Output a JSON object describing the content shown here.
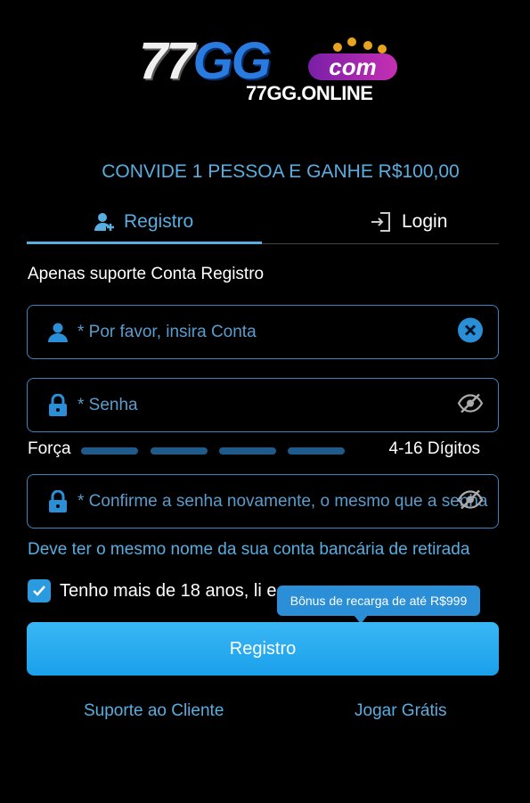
{
  "logo": {
    "main": "77",
    "accent": "GG",
    "badge": "com",
    "domain": "77GG.ONLINE"
  },
  "promo": "CONVIDE 1 PESSOA E GANHE R$100,00",
  "tabs": [
    {
      "label": "Registro",
      "icon": "user-plus-icon",
      "active": true
    },
    {
      "label": "Login",
      "icon": "login-door-icon",
      "active": false
    }
  ],
  "note": "Apenas suporte Conta Registro",
  "fields": {
    "account": {
      "placeholder": "* Por favor, insira Conta",
      "value": ""
    },
    "password": {
      "placeholder": "* Senha",
      "value": ""
    },
    "confirm": {
      "placeholder": "* Confirme a senha novamente, o mesmo que a senha",
      "value": ""
    }
  },
  "strength": {
    "label": "Força",
    "digits": "4-16 Dígitos"
  },
  "warning": "Deve ter o mesmo nome da sua conta bancária de retirada",
  "agree": {
    "text": "Tenho mais de 18 anos, li e",
    "checked": true
  },
  "tooltip": "Bônus de recarga de até R$999",
  "register_button": "Registro",
  "footer": {
    "support": "Suporte ao Cliente",
    "play_free": "Jogar Grátis"
  },
  "colors": {
    "accent": "#58aee0",
    "button": "#1aa0ea",
    "background": "#000000"
  }
}
